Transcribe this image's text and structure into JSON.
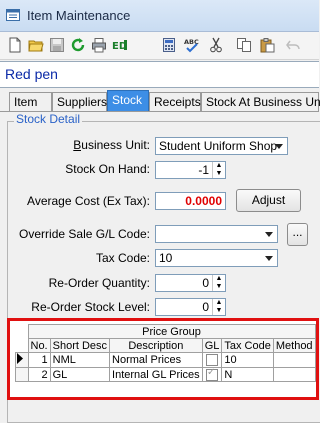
{
  "window": {
    "title": "Item Maintenance"
  },
  "toolbar": {
    "icons": [
      "new-icon",
      "open-icon",
      "save-icon",
      "refresh-icon",
      "print-icon",
      "export-icon",
      "calculator-icon",
      "spellcheck-icon",
      "cut-icon",
      "copy-icon",
      "paste-icon",
      "undo-icon"
    ]
  },
  "record": {
    "name": "Red pen"
  },
  "tabs": [
    {
      "label": "Item",
      "active": false
    },
    {
      "label": "Suppliers",
      "active": false
    },
    {
      "label": "Stock",
      "active": true
    },
    {
      "label": "Receipts",
      "active": false
    },
    {
      "label": "Stock At Business Units",
      "active": false
    }
  ],
  "stock_detail": {
    "group_label": "Stock Detail",
    "business_unit": {
      "label": "Business Unit:",
      "value": "Student Uniform Shop"
    },
    "stock_on_hand": {
      "label": "Stock On Hand:",
      "value": "-1"
    },
    "average_cost": {
      "label": "Average Cost (Ex Tax):",
      "value": "0.0000"
    },
    "adjust_button": "Adjust",
    "override_gl": {
      "label": "Override Sale G/L Code:",
      "value": "",
      "browse": "..."
    },
    "tax_code": {
      "label": "Tax Code:",
      "value": "10"
    },
    "reorder_qty": {
      "label": "Re-Order Quantity:",
      "value": "0"
    },
    "reorder_level": {
      "label": "Re-Order Stock Level:",
      "value": "0"
    }
  },
  "price_group": {
    "group_header": "Price Group",
    "columns": [
      "No.",
      "Short Desc",
      "Description",
      "GL",
      "Tax Code",
      "Method"
    ],
    "rows": [
      {
        "no": "1",
        "short": "NML",
        "desc": "Normal Prices",
        "gl": false,
        "tax": "10",
        "method": ""
      },
      {
        "no": "2",
        "short": "GL",
        "desc": "Internal GL Prices",
        "gl": true,
        "tax": "N",
        "method": ""
      }
    ]
  },
  "colors": {
    "accent_tab": "#3d8ee6",
    "group_label": "#2a62c8",
    "average_cost": "#e00000",
    "record_name": "#0b2aa8",
    "highlight_box": "#e01010"
  }
}
